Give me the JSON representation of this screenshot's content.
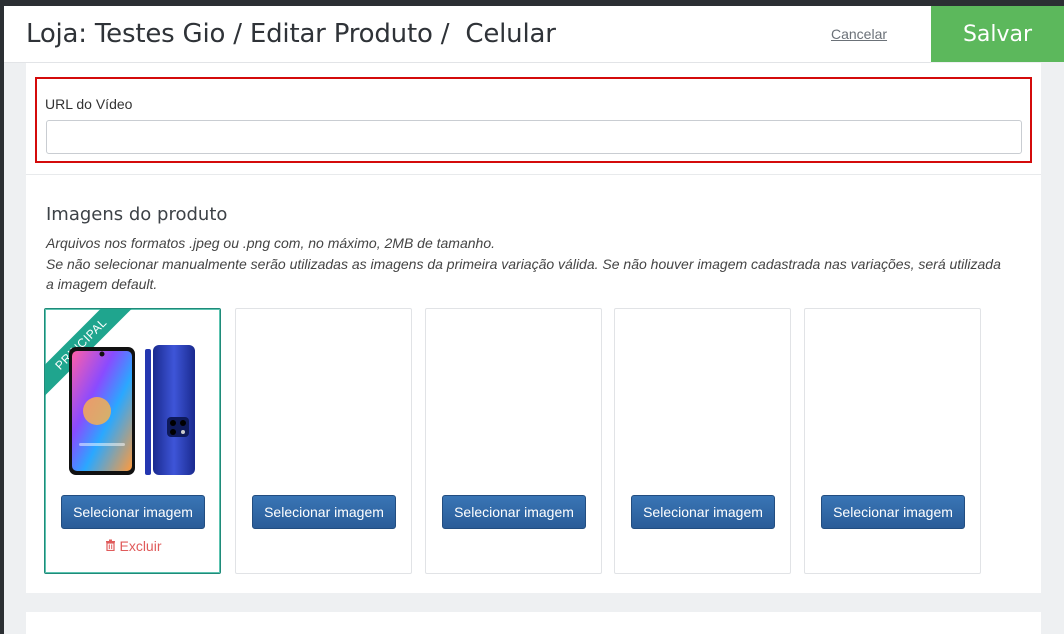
{
  "header": {
    "title": "Loja: Testes Gio / Editar Produto /  Celular",
    "cancel_label": "Cancelar",
    "save_label": "Salvar"
  },
  "video": {
    "label": "URL do Vídeo",
    "value": "",
    "placeholder": ""
  },
  "images": {
    "title": "Imagens do produto",
    "note_line1": "Arquivos nos formatos .jpeg ou .png com, no máximo, 2MB de tamanho.",
    "note_line2": "Se não selecionar manualmente serão utilizadas as imagens da primeira variação válida. Se não houver imagem cadastrada nas variações, será utilizada a imagem default.",
    "principal_badge": "PRINCIPAL",
    "slots": [
      {
        "button": "Selecionar imagem",
        "delete": "Excluir"
      },
      {
        "button": "Selecionar imagem"
      },
      {
        "button": "Selecionar imagem"
      },
      {
        "button": "Selecionar imagem"
      },
      {
        "button": "Selecionar imagem"
      }
    ]
  },
  "colors": {
    "save": "#5cb85c",
    "highlight": "#d40b0b",
    "button": "#2f68a8",
    "principal": "#1fa58e",
    "delete": "#e05b5b"
  },
  "icons": {
    "delete": "trash-icon"
  }
}
